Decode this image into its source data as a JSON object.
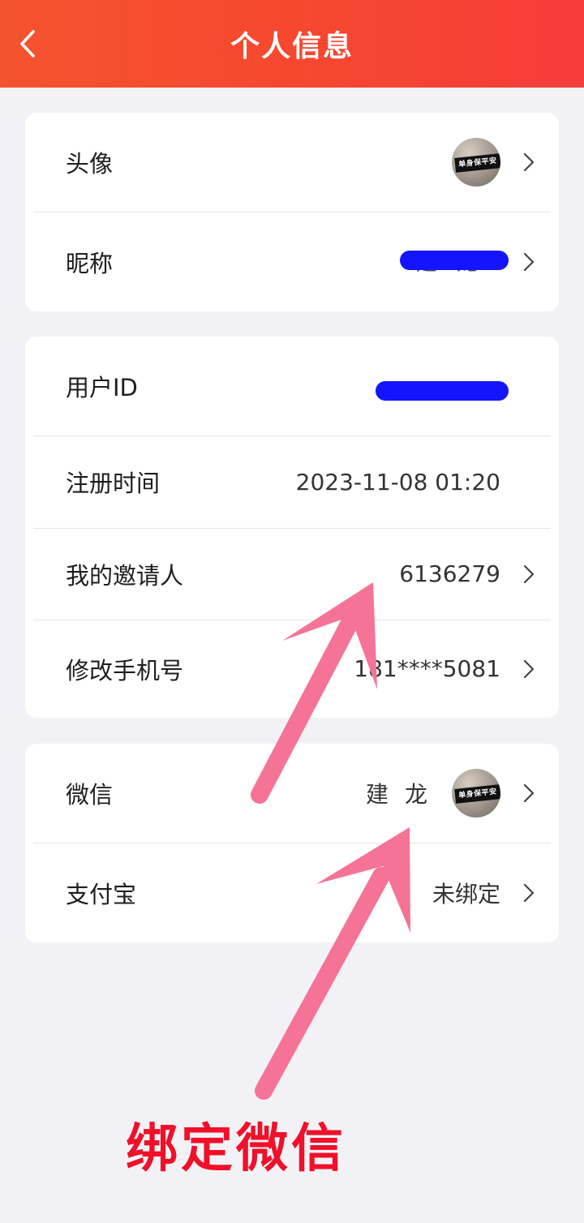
{
  "header": {
    "title": "个人信息",
    "back_icon": "chevron-left-icon"
  },
  "profile": {
    "avatar_label": "头像",
    "avatar_caption": "单身保平安",
    "nickname_label": "昵称",
    "nickname_value_visible": "建 龙"
  },
  "account": {
    "user_id_label": "用户ID",
    "register_time_label": "注册时间",
    "register_time_value": "2023-11-08 01:20",
    "inviter_label": "我的邀请人",
    "inviter_value": "6136279",
    "phone_label": "修改手机号",
    "phone_value": "181****5081"
  },
  "binding": {
    "wechat_label": "微信",
    "wechat_name": "建龙",
    "wechat_avatar_caption": "单身保平安",
    "alipay_label": "支付宝",
    "alipay_value": "未绑定"
  },
  "annotation": {
    "text": "绑定微信",
    "color": "#f0102a",
    "arrow_color": "#f57396"
  },
  "colors": {
    "header_start": "#f4532f",
    "header_end": "#f53d3a",
    "redaction": "#1414ff"
  }
}
